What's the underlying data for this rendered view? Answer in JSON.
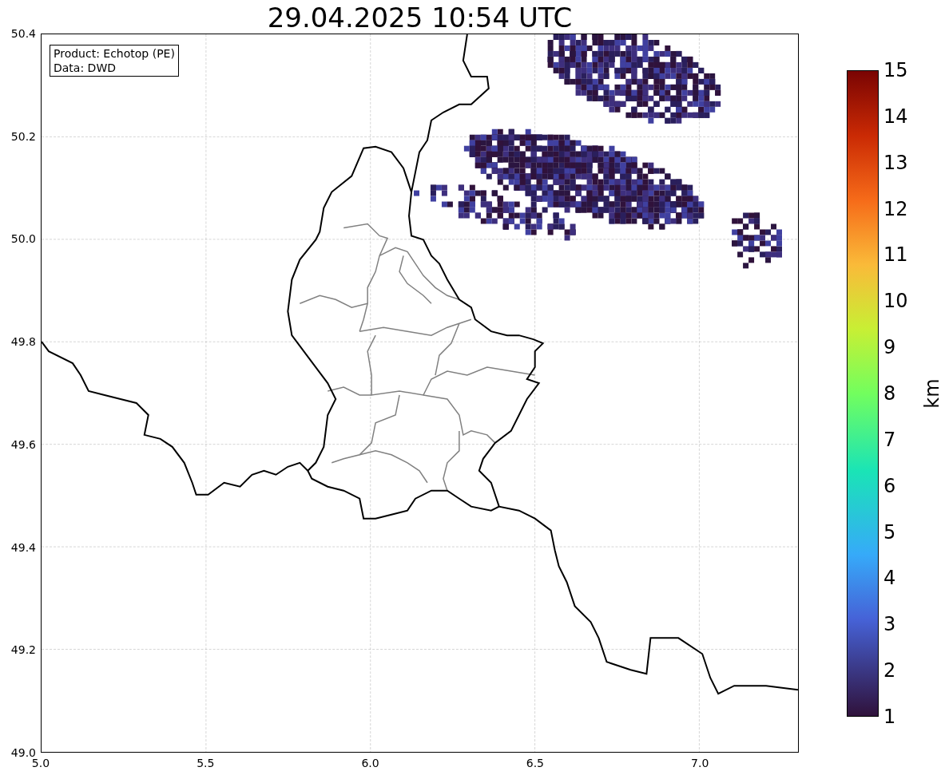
{
  "title": "29.04.2025 10:54 UTC",
  "info_box": [
    "Product: Echotop (PE)",
    "Data: DWD"
  ],
  "y_ticks": [
    "50.4",
    "50.2",
    "50.0",
    "49.8",
    "49.6",
    "49.4",
    "49.2",
    "49.0"
  ],
  "x_ticks": [
    "5.0",
    "5.5",
    "6.0",
    "6.5",
    "7.0"
  ],
  "colorbar": {
    "label": "km",
    "ticks": [
      "15",
      "14",
      "13",
      "12",
      "11",
      "10",
      "9",
      "8",
      "7",
      "6",
      "5",
      "4",
      "3",
      "2",
      "1"
    ]
  }
}
